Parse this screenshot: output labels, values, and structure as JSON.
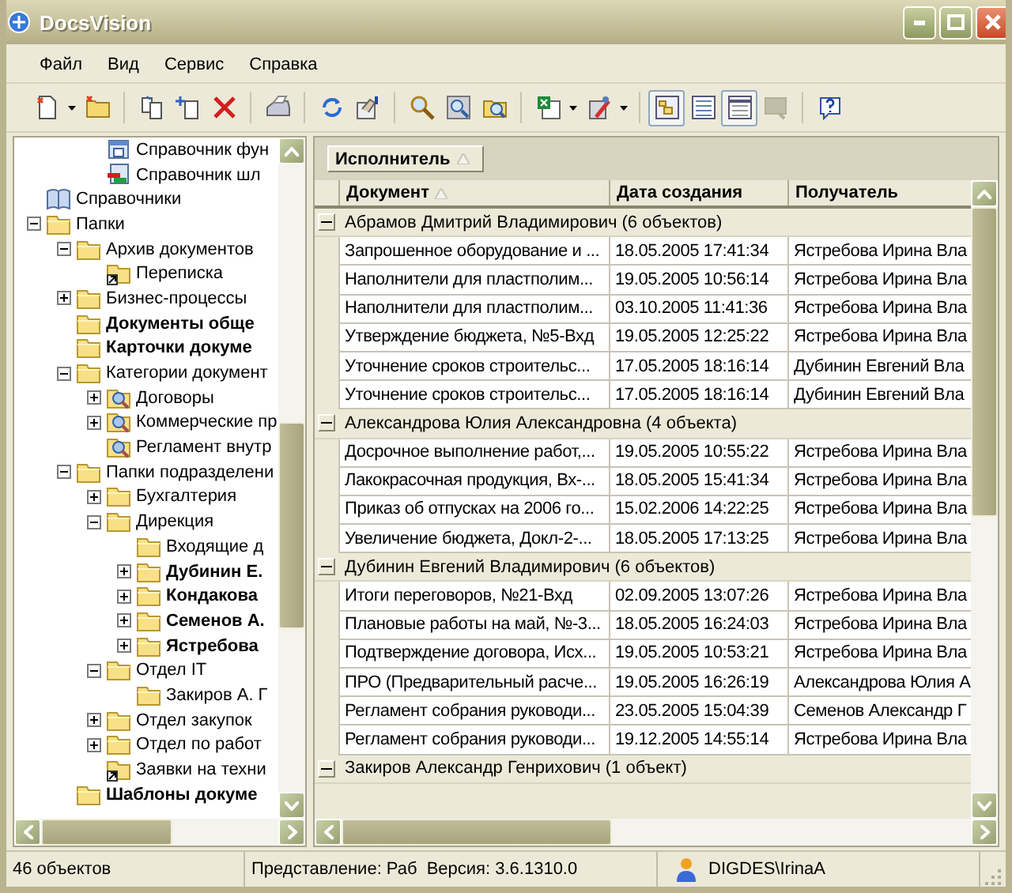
{
  "window": {
    "title": "DocsVision"
  },
  "menu": [
    {
      "label": "Файл"
    },
    {
      "label": "Вид"
    },
    {
      "label": "Сервис"
    },
    {
      "label": "Справка"
    }
  ],
  "toolbar": [
    [
      {
        "kind": "new-document",
        "dropdown": true
      },
      {
        "kind": "new-folder"
      }
    ],
    [
      {
        "kind": "copy"
      },
      {
        "kind": "paste"
      },
      {
        "kind": "delete"
      }
    ],
    [
      {
        "kind": "print"
      }
    ],
    [
      {
        "kind": "refresh"
      },
      {
        "kind": "properties"
      }
    ],
    [
      {
        "kind": "search"
      },
      {
        "kind": "find-preview"
      },
      {
        "kind": "folder-search"
      }
    ],
    [
      {
        "kind": "excel",
        "dropdown": true
      },
      {
        "kind": "tools",
        "dropdown": true
      }
    ],
    [
      {
        "kind": "view-tree",
        "selected": true
      },
      {
        "kind": "view-list",
        "selected": false
      },
      {
        "kind": "view-grid",
        "selected": true
      },
      {
        "kind": "view-preview",
        "selected": false,
        "disabled": true
      }
    ],
    [
      {
        "kind": "help"
      }
    ]
  ],
  "tree": [
    {
      "children": [
        {
          "children": [
            {
              "label": "Справочник фун",
              "kind": "app",
              "bold": false
            },
            {
              "label": "Справочник шл",
              "kind": "gateway",
              "bold": false
            }
          ]
        }
      ]
    },
    {
      "label": "Справочники",
      "kind": "book",
      "bold": false
    },
    {
      "label": "Папки",
      "kind": "folder",
      "bold": false,
      "expanded": true,
      "children": [
        {
          "label": "Архив документов",
          "kind": "folder",
          "bold": false,
          "expanded": true,
          "children": [
            {
              "label": "Переписка",
              "kind": "shortcut",
              "bold": false
            }
          ]
        },
        {
          "label": "Бизнес-процессы",
          "kind": "folder",
          "bold": false,
          "expanded": false
        },
        {
          "label": "Документы обще",
          "kind": "folder",
          "bold": true
        },
        {
          "label": "Карточки докуме",
          "kind": "folder",
          "bold": true
        },
        {
          "label": "Категории документ",
          "kind": "folder",
          "bold": false,
          "expanded": true,
          "children": [
            {
              "label": "Договоры",
              "kind": "search-folder",
              "bold": false,
              "expanded": false
            },
            {
              "label": "Коммерческие пр",
              "kind": "search-folder",
              "bold": false,
              "expanded": false
            },
            {
              "label": "Регламент внутр",
              "kind": "search-folder",
              "bold": false
            }
          ]
        },
        {
          "label": "Папки подразделени",
          "kind": "folder",
          "bold": false,
          "expanded": true,
          "children": [
            {
              "label": "Бухгалтерия",
              "kind": "folder",
              "bold": false,
              "expanded": false
            },
            {
              "label": "Дирекция",
              "kind": "folder",
              "bold": false,
              "expanded": true,
              "children": [
                {
                  "label": "Входящие д",
                  "kind": "folder",
                  "bold": false
                },
                {
                  "label": "Дубинин Е.",
                  "kind": "folder",
                  "bold": true,
                  "expanded": false
                },
                {
                  "label": "Кондакова",
                  "kind": "folder",
                  "bold": true,
                  "expanded": false
                },
                {
                  "label": "Семенов А.",
                  "kind": "folder",
                  "bold": true,
                  "expanded": false
                },
                {
                  "label": "Ястребова",
                  "kind": "folder",
                  "bold": true,
                  "expanded": false
                }
              ]
            },
            {
              "label": "Отдел IT",
              "kind": "folder",
              "bold": false,
              "expanded": true,
              "children": [
                {
                  "label": "Закиров А. Г",
                  "kind": "folder",
                  "bold": false
                }
              ]
            },
            {
              "label": "Отдел закупок",
              "kind": "folder",
              "bold": false,
              "expanded": false
            },
            {
              "label": "Отдел по работ",
              "kind": "folder",
              "bold": false,
              "expanded": false
            },
            {
              "label": "Заявки на техни",
              "kind": "shortcut",
              "bold": false
            }
          ]
        },
        {
          "label": "Шаблоны докуме",
          "kind": "folder",
          "bold": true
        }
      ]
    }
  ],
  "grid": {
    "group_by": {
      "label": "Исполнитель",
      "sorted": true
    },
    "columns": [
      {
        "label": "Документ",
        "sorted": true
      },
      {
        "label": "Дата создания",
        "sorted": false
      },
      {
        "label": "Получатель",
        "sorted": false
      }
    ],
    "groups": [
      {
        "label": "Абрамов Дмитрий Владимирович (6 объектов)",
        "expanded": true,
        "rows": [
          [
            "Запрошенное оборудование и ...",
            "18.05.2005 17:41:34",
            "Ястребова Ирина Вла"
          ],
          [
            "Наполнители для пластполим...",
            "19.05.2005 10:56:14",
            "Ястребова Ирина Вла"
          ],
          [
            "Наполнители для пластполим...",
            "03.10.2005 11:41:36",
            "Ястребова Ирина Вла"
          ],
          [
            "Утверждение бюджета, №5-Вхд",
            "19.05.2005 12:25:22",
            "Ястребова Ирина Вла"
          ],
          [
            "Уточнение сроков строительс...",
            "17.05.2005 18:16:14",
            "Дубинин Евгений Вла"
          ],
          [
            "Уточнение сроков строительс...",
            "17.05.2005 18:16:14",
            "Дубинин Евгений Вла"
          ]
        ]
      },
      {
        "label": "Александрова Юлия Александровна (4 объекта)",
        "expanded": true,
        "rows": [
          [
            "Досрочное выполнение работ,...",
            "19.05.2005 10:55:22",
            "Ястребова Ирина Вла"
          ],
          [
            "Лакокрасочная продукция, Вх-...",
            "18.05.2005 15:41:34",
            "Ястребова Ирина Вла"
          ],
          [
            "Приказ об отпусках на 2006 го...",
            "15.02.2006 14:22:25",
            "Ястребова Ирина Вла"
          ],
          [
            "Увеличение бюджета, Докл-2-...",
            "18.05.2005 17:13:25",
            "Ястребова Ирина Вла"
          ]
        ]
      },
      {
        "label": "Дубинин Евгений Владимирович (6 объектов)",
        "expanded": true,
        "rows": [
          [
            "Итоги переговоров, №21-Вхд",
            "02.09.2005 13:07:26",
            "Ястребова Ирина Вла"
          ],
          [
            "Плановые работы на май, №-3...",
            "18.05.2005 16:24:03",
            "Ястребова Ирина Вла"
          ],
          [
            "Подтверждение договора, Исх...",
            "19.05.2005 10:53:21",
            "Ястребова Ирина Вла"
          ],
          [
            "ПРО (Предварительный расче...",
            "19.05.2005 16:26:19",
            "Александрова Юлия А"
          ],
          [
            "Регламент собрания руководи...",
            "23.05.2005 15:04:39",
            "Семенов Александр Г"
          ],
          [
            "Регламент собрания руководи...",
            "19.12.2005 14:55:14",
            "Ястребова Ирина Вла"
          ]
        ]
      },
      {
        "label": "Закиров Александр Генрихович (1 объект)",
        "expanded": true
      }
    ]
  },
  "status_bar": {
    "count": "46 объектов",
    "view": "Представление: Раб",
    "version": "Версия: 3.6.1310.0",
    "user": "DIGDES\\IrinaA"
  }
}
